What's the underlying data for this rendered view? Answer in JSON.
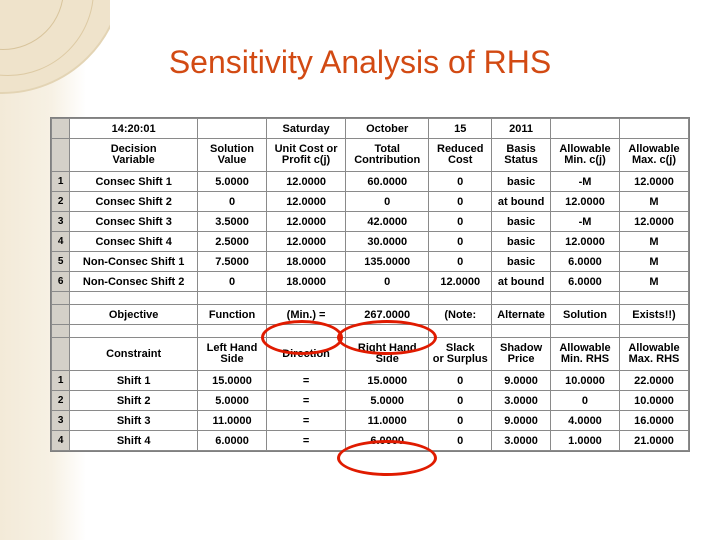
{
  "title": "Sensitivity Analysis of RHS",
  "sheet": {
    "info_row": {
      "time": "14:20:01",
      "blank1": "",
      "day": "Saturday",
      "month": "October",
      "date": "15",
      "year": "2011",
      "blank2": "",
      "blank3": ""
    },
    "variable_headers": [
      "Decision\nVariable",
      "Solution\nValue",
      "Unit Cost or\nProfit c(j)",
      "Total\nContribution",
      "Reduced\nCost",
      "Basis\nStatus",
      "Allowable\nMin. c(j)",
      "Allowable\nMax. c(j)"
    ],
    "variable_headers_l1": [
      "Decision",
      "Solution",
      "Unit Cost or",
      "Total",
      "Reduced",
      "Basis",
      "Allowable",
      "Allowable"
    ],
    "variable_headers_l2": [
      "Variable",
      "Value",
      "Profit c(j)",
      "Contribution",
      "Cost",
      "Status",
      "Min. c(j)",
      "Max. c(j)"
    ],
    "variable_rows": [
      {
        "num": "1",
        "name": "Consec Shift 1",
        "solution": "5.0000",
        "unit_cost": "12.0000",
        "total_contribution": "60.0000",
        "reduced_cost": "0",
        "basis_status": "basic",
        "allow_min": "-M",
        "allow_max": "12.0000"
      },
      {
        "num": "2",
        "name": "Consec Shift 2",
        "solution": "0",
        "unit_cost": "12.0000",
        "total_contribution": "0",
        "reduced_cost": "0",
        "basis_status": "at bound",
        "allow_min": "12.0000",
        "allow_max": "M"
      },
      {
        "num": "3",
        "name": "Consec Shift 3",
        "solution": "3.5000",
        "unit_cost": "12.0000",
        "total_contribution": "42.0000",
        "reduced_cost": "0",
        "basis_status": "basic",
        "allow_min": "-M",
        "allow_max": "12.0000"
      },
      {
        "num": "4",
        "name": "Consec Shift 4",
        "solution": "2.5000",
        "unit_cost": "12.0000",
        "total_contribution": "30.0000",
        "reduced_cost": "0",
        "basis_status": "basic",
        "allow_min": "12.0000",
        "allow_max": "M"
      },
      {
        "num": "5",
        "name": "Non-Consec Shift 1",
        "solution": "7.5000",
        "unit_cost": "18.0000",
        "total_contribution": "135.0000",
        "reduced_cost": "0",
        "basis_status": "basic",
        "allow_min": "6.0000",
        "allow_max": "M"
      },
      {
        "num": "6",
        "name": "Non-Consec Shift 2",
        "solution": "0",
        "unit_cost": "18.0000",
        "total_contribution": "0",
        "reduced_cost": "12.0000",
        "basis_status": "at bound",
        "allow_min": "6.0000",
        "allow_max": "M"
      }
    ],
    "objective_row": {
      "label": "Objective",
      "function": "Function",
      "direction": "(Min.) =",
      "value": "267.0000",
      "note": "(Note:",
      "alternate": "Alternate",
      "solution": "Solution",
      "exists": "Exists!!)"
    },
    "constraint_headers_l1": [
      "",
      "Left Hand",
      "",
      "Right Hand",
      "Slack",
      "Shadow",
      "Allowable",
      "Allowable"
    ],
    "constraint_headers_l2": [
      "Constraint",
      "Side",
      "Direction",
      "Side",
      "or Surplus",
      "Price",
      "Min. RHS",
      "Max. RHS"
    ],
    "constraint_rows": [
      {
        "num": "1",
        "name": "Shift 1",
        "lhs": "15.0000",
        "direction": "=",
        "rhs": "15.0000",
        "slack": "0",
        "shadow_price": "9.0000",
        "allow_min_rhs": "10.0000",
        "allow_max_rhs": "22.0000"
      },
      {
        "num": "2",
        "name": "Shift 2",
        "lhs": "5.0000",
        "direction": "=",
        "rhs": "5.0000",
        "slack": "0",
        "shadow_price": "3.0000",
        "allow_min_rhs": "0",
        "allow_max_rhs": "10.0000"
      },
      {
        "num": "3",
        "name": "Shift 3",
        "lhs": "11.0000",
        "direction": "=",
        "rhs": "11.0000",
        "slack": "0",
        "shadow_price": "9.0000",
        "allow_min_rhs": "4.0000",
        "allow_max_rhs": "16.0000"
      },
      {
        "num": "4",
        "name": "Shift 4",
        "lhs": "6.0000",
        "direction": "=",
        "rhs": "6.0000",
        "slack": "0",
        "shadow_price": "3.0000",
        "allow_min_rhs": "1.0000",
        "allow_max_rhs": "21.0000"
      }
    ]
  },
  "annotations": {
    "highlight_color": "#e01b00",
    "circled": [
      "(Min.) =",
      "267.0000",
      "11.0000"
    ]
  }
}
